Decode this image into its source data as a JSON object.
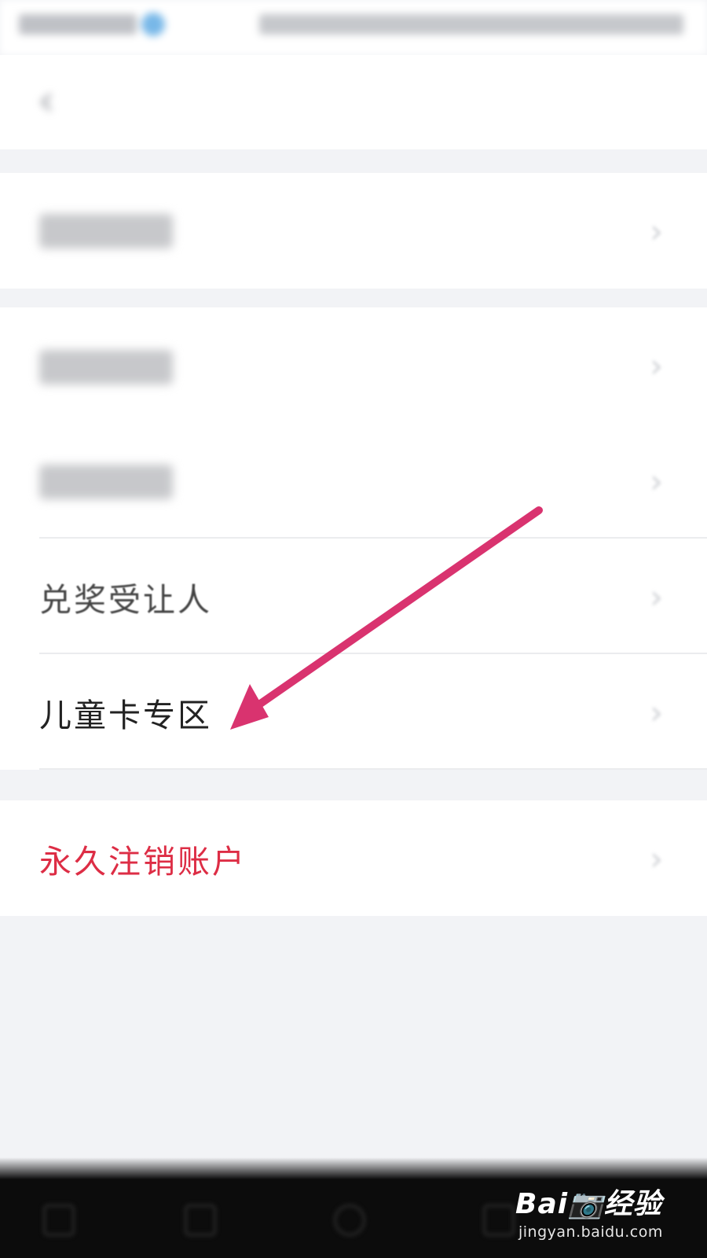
{
  "status_bar": {
    "carrier": "",
    "indicators": ""
  },
  "header": {
    "back_icon": "chevron-left-icon",
    "title": ""
  },
  "sections": [
    {
      "items": [
        {
          "label": "",
          "obscured": true
        }
      ]
    },
    {
      "items": [
        {
          "label": "",
          "obscured": true
        },
        {
          "label": "",
          "obscured": true
        },
        {
          "label": "兑奖受让人",
          "obscured": false
        },
        {
          "label": "儿童卡专区",
          "obscured": false
        }
      ]
    },
    {
      "items": [
        {
          "label": "永久注销账户",
          "obscured": false,
          "color": "#dd2d45"
        }
      ]
    }
  ],
  "chevron_icon": "chevron-right-icon",
  "annotation": {
    "type": "arrow",
    "color": "#d9336f",
    "points_to": "儿童卡专区"
  },
  "watermark": {
    "brand": "Bai📷经验",
    "url": "jingyan.baidu.com"
  },
  "colors": {
    "background": "#f2f3f6",
    "surface": "#ffffff",
    "danger": "#dd2d45",
    "arrow": "#d9336f"
  }
}
